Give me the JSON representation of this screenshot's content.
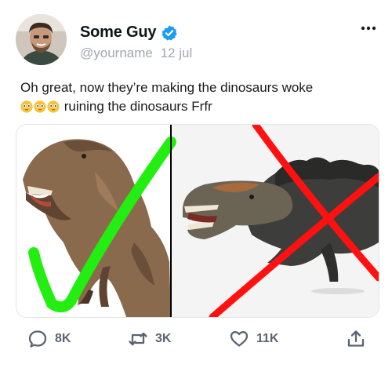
{
  "tweet": {
    "author": {
      "display_name": "Some Guy",
      "handle": "@yourname",
      "verified": true,
      "avatar": "profile-photo"
    },
    "date": "12 jul",
    "text_line1": "Oh great, now they’re making the dinosaurs woke",
    "text_line2": "ruining the dinosaurs Frfr",
    "emojis": [
      "flushed-face",
      "flushed-face",
      "flushed-face"
    ],
    "media": {
      "left": {
        "subject": "t-rex-scaly",
        "mark": "green-checkmark"
      },
      "right": {
        "subject": "t-rex-feathered",
        "mark": "red-x"
      }
    },
    "actions": {
      "replies": "8K",
      "retweets": "3K",
      "likes": "11K"
    }
  },
  "colors": {
    "verified": "#1d9bf0",
    "check": "#22ee11",
    "cross": "#ff1111",
    "muted": "#5b6470",
    "handle": "#a2a8b0"
  }
}
